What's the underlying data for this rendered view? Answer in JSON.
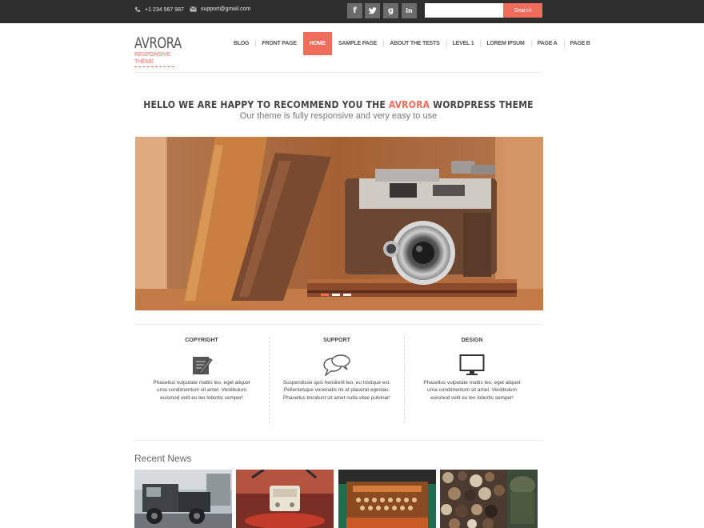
{
  "topbar": {
    "phone": "+1 234 567 987",
    "email": "support@gmail.com",
    "social": [
      {
        "icon": "facebook-icon",
        "glyph": "f"
      },
      {
        "icon": "twitter-icon",
        "glyph": "t"
      },
      {
        "icon": "google-plus-icon",
        "glyph": "g"
      },
      {
        "icon": "linkedin-icon",
        "glyph": "in"
      }
    ],
    "search_placeholder": "",
    "search_button": "Search"
  },
  "logo": {
    "title": "AVRORA",
    "tagline": "RESPONSIVE THEME"
  },
  "nav": {
    "items": [
      "BLOG",
      "FRONT PAGE",
      "HOME",
      "SAMPLE PAGE",
      "ABOUT THE TESTS",
      "LEVEL 1",
      "LOREM IPSUM",
      "PAGE A",
      "PAGE B"
    ],
    "active": "HOME"
  },
  "welcome": {
    "title_before": "HELLO WE ARE HAPPY TO RECOMMEND YOU THE ",
    "title_accent": "AVRORA",
    "title_after": " WORDPRESS THEME",
    "subtitle": "Our theme is fully responsive and very easy to use"
  },
  "slider": {
    "slides": 3,
    "active_slide": 1
  },
  "features": [
    {
      "title": "COPYRIGHT",
      "icon": "notepad-pencil-icon",
      "text": "Phasellus vulputate mattis leo, eget aliquet urna condimentum sit amet. Vestibulum euismod velit eu leo lobortis semper!"
    },
    {
      "title": "SUPPORT",
      "icon": "chat-bubbles-icon",
      "text": "Suspendisse quis hendrerit leo, eu tristique est. Pellentesque venenatis mi at placerat egestas. Phasellus tincidunt sit amet nulla vitae pulvinar!"
    },
    {
      "title": "DESIGN",
      "icon": "monitor-icon",
      "text": "Phasellus vulputate mattis leo, eget aliquet urna condimentum sit amet. Vestibulum euismod velit eu leo lobortis semper!"
    }
  ],
  "recent": {
    "title": "Recent News"
  },
  "colors": {
    "accent": "#f06c5b",
    "topbar": "#2f2f2f",
    "social_button": "#6b6b6b"
  }
}
